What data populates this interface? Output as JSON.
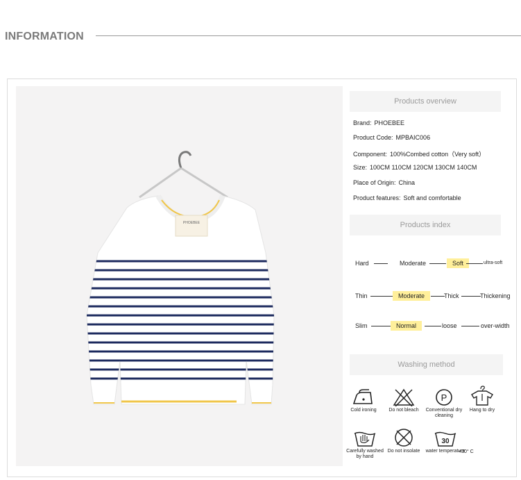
{
  "header": {
    "title": "INFORMATION"
  },
  "product_image": {
    "label_text": "PHOEBEE",
    "stripe_color": "#1c2a5e",
    "accent_color": "#f0c64a",
    "body_color": "#ffffff"
  },
  "overview": {
    "title": "Products overview",
    "rows": [
      {
        "label": "Brand:",
        "value": "PHOEBEE"
      },
      {
        "label": "Product Code:",
        "value": "MPBAIC006"
      },
      {
        "label": "Component:",
        "value": "100%Combed cotton（Very soft）"
      },
      {
        "label": "Size:",
        "value": "100CM  110CM  120CM  130CM  140CM"
      },
      {
        "label": "Place of Origin:",
        "value": "China"
      },
      {
        "label": "Product features:",
        "value": "Soft and comfortable"
      }
    ]
  },
  "index": {
    "title": "Products index",
    "scales": [
      {
        "items": [
          "Hard",
          "Moderate",
          "Soft",
          "ultra-soft"
        ],
        "selected": "Soft"
      },
      {
        "items": [
          "Thin",
          "Moderate",
          "Thick",
          "Thickening"
        ],
        "selected": "Moderate"
      },
      {
        "items": [
          "Slim",
          "Normal",
          "loose",
          "over-width"
        ],
        "selected": "Normal"
      }
    ],
    "highlight_color": "#ffef9a"
  },
  "washing": {
    "title": "Washing method",
    "icons": [
      {
        "icon": "iron-icon",
        "label": "Cold ironing"
      },
      {
        "icon": "no-bleach-icon",
        "label": "Do not bleach"
      },
      {
        "icon": "dry-clean-p-icon",
        "label": "Conventional dry cleaning"
      },
      {
        "icon": "hang-dry-icon",
        "label": "Hang to dry"
      },
      {
        "icon": "hand-wash-icon",
        "label": "Carefully washed by hand"
      },
      {
        "icon": "no-tumble-dry-icon",
        "label": "Do not insolate"
      },
      {
        "icon": "wash-30-icon",
        "label": "water temperature",
        "value": "30",
        "extra": "<30° C"
      }
    ]
  }
}
